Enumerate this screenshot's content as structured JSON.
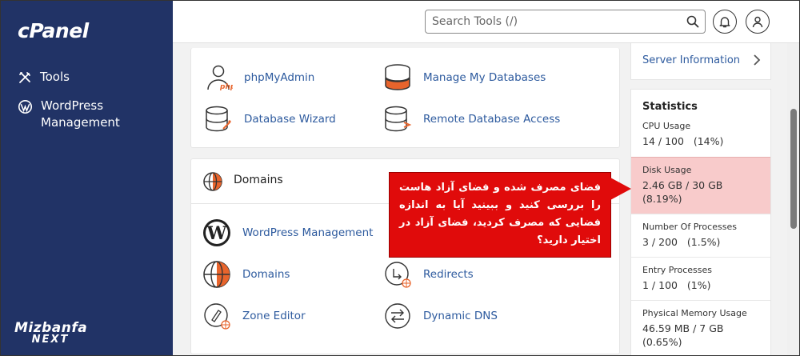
{
  "sidebar": {
    "logo": "cPanel",
    "items": [
      {
        "label": "Tools",
        "icon": "tools-icon"
      },
      {
        "label": "WordPress Management",
        "icon": "wordpress-icon"
      }
    ],
    "brand_line1": "Mizbanfa",
    "brand_line2": "NEXT"
  },
  "topbar": {
    "search_placeholder": "Search Tools (/)",
    "icons": [
      "search-icon",
      "bell-icon",
      "user-icon"
    ]
  },
  "databases": {
    "tools": [
      {
        "label": "phpMyAdmin",
        "icon": "phpmyadmin-icon"
      },
      {
        "label": "Manage My Databases",
        "icon": "manage-databases-icon"
      },
      {
        "label": "Database Wizard",
        "icon": "database-wizard-icon"
      },
      {
        "label": "Remote Database Access",
        "icon": "remote-database-icon"
      }
    ]
  },
  "domains": {
    "title": "Domains",
    "tools": [
      {
        "label": "WordPress Management",
        "icon": "wordpress-icon"
      },
      {
        "label": "Domains",
        "icon": "globe-icon"
      },
      {
        "label": "Redirects",
        "icon": "redirects-icon"
      },
      {
        "label": "Zone Editor",
        "icon": "zone-editor-icon"
      },
      {
        "label": "Dynamic DNS",
        "icon": "dynamic-dns-icon"
      }
    ]
  },
  "right_panel": {
    "server_info": "Server Information",
    "statistics_title": "Statistics",
    "stats": [
      {
        "label": "CPU Usage",
        "value": "14 / 100   (14%)"
      },
      {
        "label": "Disk Usage",
        "value": "2.46 GB / 30 GB (8.19%)"
      },
      {
        "label": "Number Of Processes",
        "value": "3 / 200   (1.5%)"
      },
      {
        "label": "Entry Processes",
        "value": "1 / 100   (1%)"
      },
      {
        "label": "Physical Memory Usage",
        "value": "46.59 MB / 7 GB (0.65%)"
      }
    ]
  },
  "annotation": {
    "text": "فضای مصرف شده و فضای آزاد هاست را بررسی کنید و ببینید آیا به اندازه فضایی که مصرف کردید، فضای آزاد در اختیار دارید؟"
  },
  "colors": {
    "sidebar_bg": "#213366",
    "link": "#2d5a9e",
    "highlight": "#f8cbcb",
    "callout": "#e00b0b",
    "db_orange": "#e8642c"
  }
}
